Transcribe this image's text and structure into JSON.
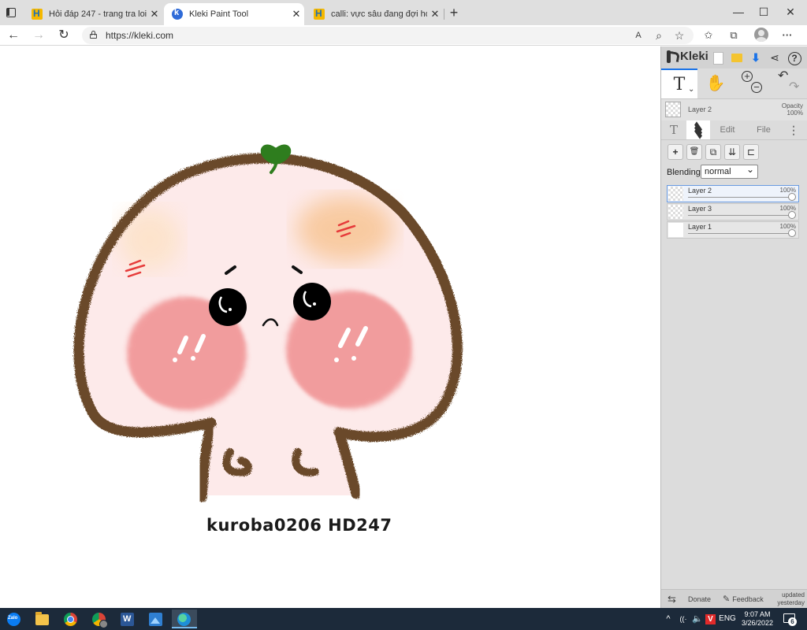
{
  "browser": {
    "tabs": [
      {
        "title": "Hỏi đáp 247 - trang tra loi",
        "favicon": "hoidap247-favicon",
        "active": false
      },
      {
        "title": "Kleki Paint Tool",
        "favicon": "kleki-favicon",
        "active": true
      },
      {
        "title": "calli: vực sâu đang đợi hoặc mãn",
        "favicon": "hoidap247-favicon",
        "active": false
      }
    ],
    "tab_close_glyph": "✕",
    "new_tab_glyph": "+",
    "window": {
      "minimize": "—",
      "maximize": "☐",
      "close": "✕"
    },
    "url": "https://kleki.com",
    "nav": {
      "back": "←",
      "forward": "→",
      "refresh": "↻"
    },
    "toolbar_icons": [
      "read-aloud-icon",
      "zoom-icon",
      "add-favorite-icon",
      "favorites-icon",
      "collections-icon",
      "profile-icon",
      "more-icon"
    ],
    "toolbar_glyphs": {
      "read_aloud": "A",
      "zoom": "⌕",
      "add_favorite": "☆",
      "favorites": "✩",
      "collections": "⧉",
      "more": "···"
    }
  },
  "canvas": {
    "watermark": "kuroba0206  HD247",
    "colors": {
      "outline": "#6b4a2b",
      "face": "#fbe3e3",
      "blush": "#f0898a",
      "sprout": "#2e7d1e",
      "orange_blush": "#f7c79b",
      "marks": "#e63a3a"
    }
  },
  "kleki": {
    "logo_text": "Kleki",
    "top_icons": {
      "new": "new-image-icon",
      "open": "open-icon",
      "save": "download-icon",
      "share": "share-icon",
      "help": "help-icon"
    },
    "top_glyphs": {
      "save": "⬇",
      "share": "⋖",
      "help": "?"
    },
    "tools": {
      "text": "T",
      "text_caret": "⌄",
      "hand": "✋",
      "zoom_in": "+",
      "zoom_out": "−",
      "undo": "↶",
      "redo": "↷"
    },
    "current_layer": {
      "name": "Layer 2",
      "opacity_label": "Opacity",
      "opacity_value": "100%"
    },
    "tabs": {
      "brush": "T",
      "edit": "Edit",
      "file": "File",
      "more": "⋮"
    },
    "layer_buttons": {
      "add": "+",
      "delete": "🗑",
      "duplicate": "⧉",
      "merge": "⇊",
      "rename": "⊏"
    },
    "blending_label": "Blending",
    "blending_value": "normal",
    "layers": [
      {
        "name": "Layer 2",
        "opacity": "100%",
        "selected": true
      },
      {
        "name": "Layer 3",
        "opacity": "100%",
        "selected": false
      },
      {
        "name": "Layer 1",
        "opacity": "100%",
        "selected": false
      }
    ],
    "footer": {
      "swap": "⇆",
      "donate": "Donate",
      "feedback_icon": "✎",
      "feedback": "Feedback",
      "updated_line1": "updated",
      "updated_line2": "yesterday"
    }
  },
  "taskbar": {
    "apps": [
      "zalo-icon",
      "file-explorer-icon",
      "chrome-icon",
      "chrome-profile-icon",
      "word-icon",
      "photos-icon",
      "edge-icon"
    ],
    "tray": {
      "chevron": "^",
      "wifi": "((·",
      "volume": "🔈",
      "vietkey": "V",
      "lang": "ENG"
    },
    "time": "9:07 AM",
    "date": "3/26/2022",
    "notifications": "6"
  }
}
